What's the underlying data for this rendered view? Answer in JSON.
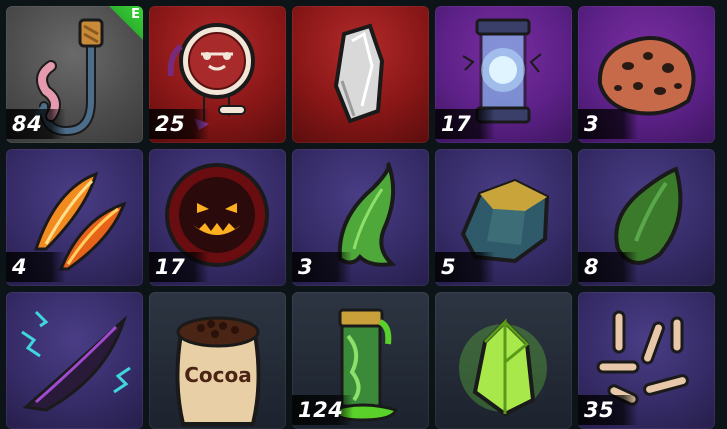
{
  "inventory": {
    "slots": [
      {
        "item": "fishing-hook-with-worm",
        "count": "84",
        "badge": "E",
        "bg": "#5a5a5a"
      },
      {
        "item": "dreamcatcher",
        "count": "25",
        "badge": "",
        "bg": "#8a1717"
      },
      {
        "item": "silver-crystal-shard",
        "count": "",
        "badge": "",
        "bg": "#8a1717"
      },
      {
        "item": "tesla-energy-canister",
        "count": "17",
        "badge": "",
        "bg": "#5d2188"
      },
      {
        "item": "cookie-rock",
        "count": "3",
        "badge": "",
        "bg": "#5d2188"
      },
      {
        "item": "phoenix-feathers",
        "count": "4",
        "badge": "",
        "bg": "#3a2f6e"
      },
      {
        "item": "jack-o-lantern-orb",
        "count": "17",
        "badge": "",
        "bg": "#3a2f6e"
      },
      {
        "item": "green-tentacle-fin",
        "count": "3",
        "badge": "",
        "bg": "#3a2f6e"
      },
      {
        "item": "mossy-stone",
        "count": "5",
        "badge": "",
        "bg": "#3a2f6e"
      },
      {
        "item": "green-seed",
        "count": "8",
        "badge": "",
        "bg": "#3a2f6e"
      },
      {
        "item": "electric-dark-feather",
        "count": "",
        "badge": "",
        "bg": "#3a2f6e"
      },
      {
        "item": "cocoa-sack",
        "count": "",
        "badge": "",
        "bg": "#1c232e"
      },
      {
        "item": "toxic-slime-canister",
        "count": "124",
        "badge": "",
        "bg": "#1c232e"
      },
      {
        "item": "glowing-green-crystal",
        "count": "",
        "badge": "",
        "bg": "#1c232e"
      },
      {
        "item": "scattered-bones",
        "count": "35",
        "badge": "",
        "bg": "#3a2f6e"
      }
    ],
    "cocoa_label": "Cocoa"
  }
}
